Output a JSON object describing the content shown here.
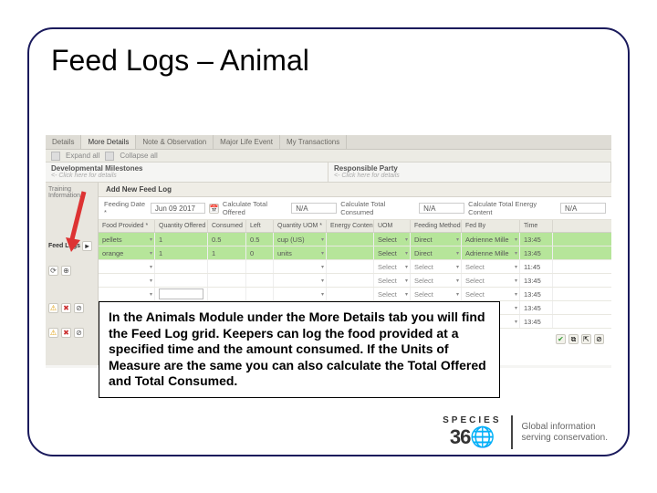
{
  "title": "Feed Logs – Animal",
  "tabs": [
    "Details",
    "More Details",
    "Note & Observation",
    "Major Life Event",
    "My Transactions"
  ],
  "toolbar": {
    "expand": "Expand all",
    "collapse": "Collapse all"
  },
  "panels": {
    "left": {
      "title": "Developmental Milestones",
      "hint": "<- Click here for details"
    },
    "right": {
      "title": "Responsible Party",
      "hint": "<- Click here for details"
    }
  },
  "sidebar": {
    "training": "Training Information",
    "feedlogs": "Feed Logs"
  },
  "dialog": {
    "title": "Add New Feed Log",
    "feeding_date_label": "Feeding Date *",
    "feeding_date": "Jun 09 2017",
    "calc_offered_label": "Calculate Total Offered",
    "calc_offered": "N/A",
    "calc_consumed_label": "Calculate Total Consumed",
    "calc_consumed": "N/A",
    "calc_energy_label": "Calculate Total Energy Content",
    "calc_energy": "N/A"
  },
  "columns": [
    "Food Provided *",
    "Quantity Offered *",
    "Consumed",
    "Left",
    "Quantity UOM *",
    "Energy Content",
    "UOM",
    "Feeding Method",
    "Fed By",
    "Time"
  ],
  "rows": [
    {
      "food": "pellets",
      "offered": "1",
      "consumed": "0.5",
      "left": "0.5",
      "uom": "cup (US)",
      "energy": "",
      "euom": "Select",
      "method": "Direct",
      "fedby": "Adrienne Mille",
      "time": "13:45"
    },
    {
      "food": "orange",
      "offered": "1",
      "consumed": "1",
      "left": "0",
      "uom": "units",
      "energy": "",
      "euom": "Select",
      "method": "Direct",
      "fedby": "Adrienne Mille",
      "time": "13:45"
    }
  ],
  "empty_rows": [
    {
      "euom": "Select",
      "method": "Select",
      "fedby": "Select",
      "time": "11:45"
    },
    {
      "euom": "Select",
      "method": "Select",
      "fedby": "Select",
      "time": "13:45"
    },
    {
      "euom": "Select",
      "method": "Select",
      "fedby": "Select",
      "time": "13:45"
    },
    {
      "euom": "Select",
      "method": "Select",
      "fedby": "Select",
      "time": "13:45"
    },
    {
      "euom": "Select",
      "method": "Select",
      "fedby": "Select",
      "time": "13:45"
    }
  ],
  "select_placeholder": "Select",
  "callout": "In the Animals Module under the More Details tab you will find the Feed Log grid. Keepers can log the food provided at a specified time and the amount consumed. If the Units of Measure are the same you can also calculate the Total Offered and Total Consumed.",
  "brand": {
    "name": "SPECIES",
    "num": "36",
    "tagline1": "Global information",
    "tagline2": "serving conservation."
  }
}
